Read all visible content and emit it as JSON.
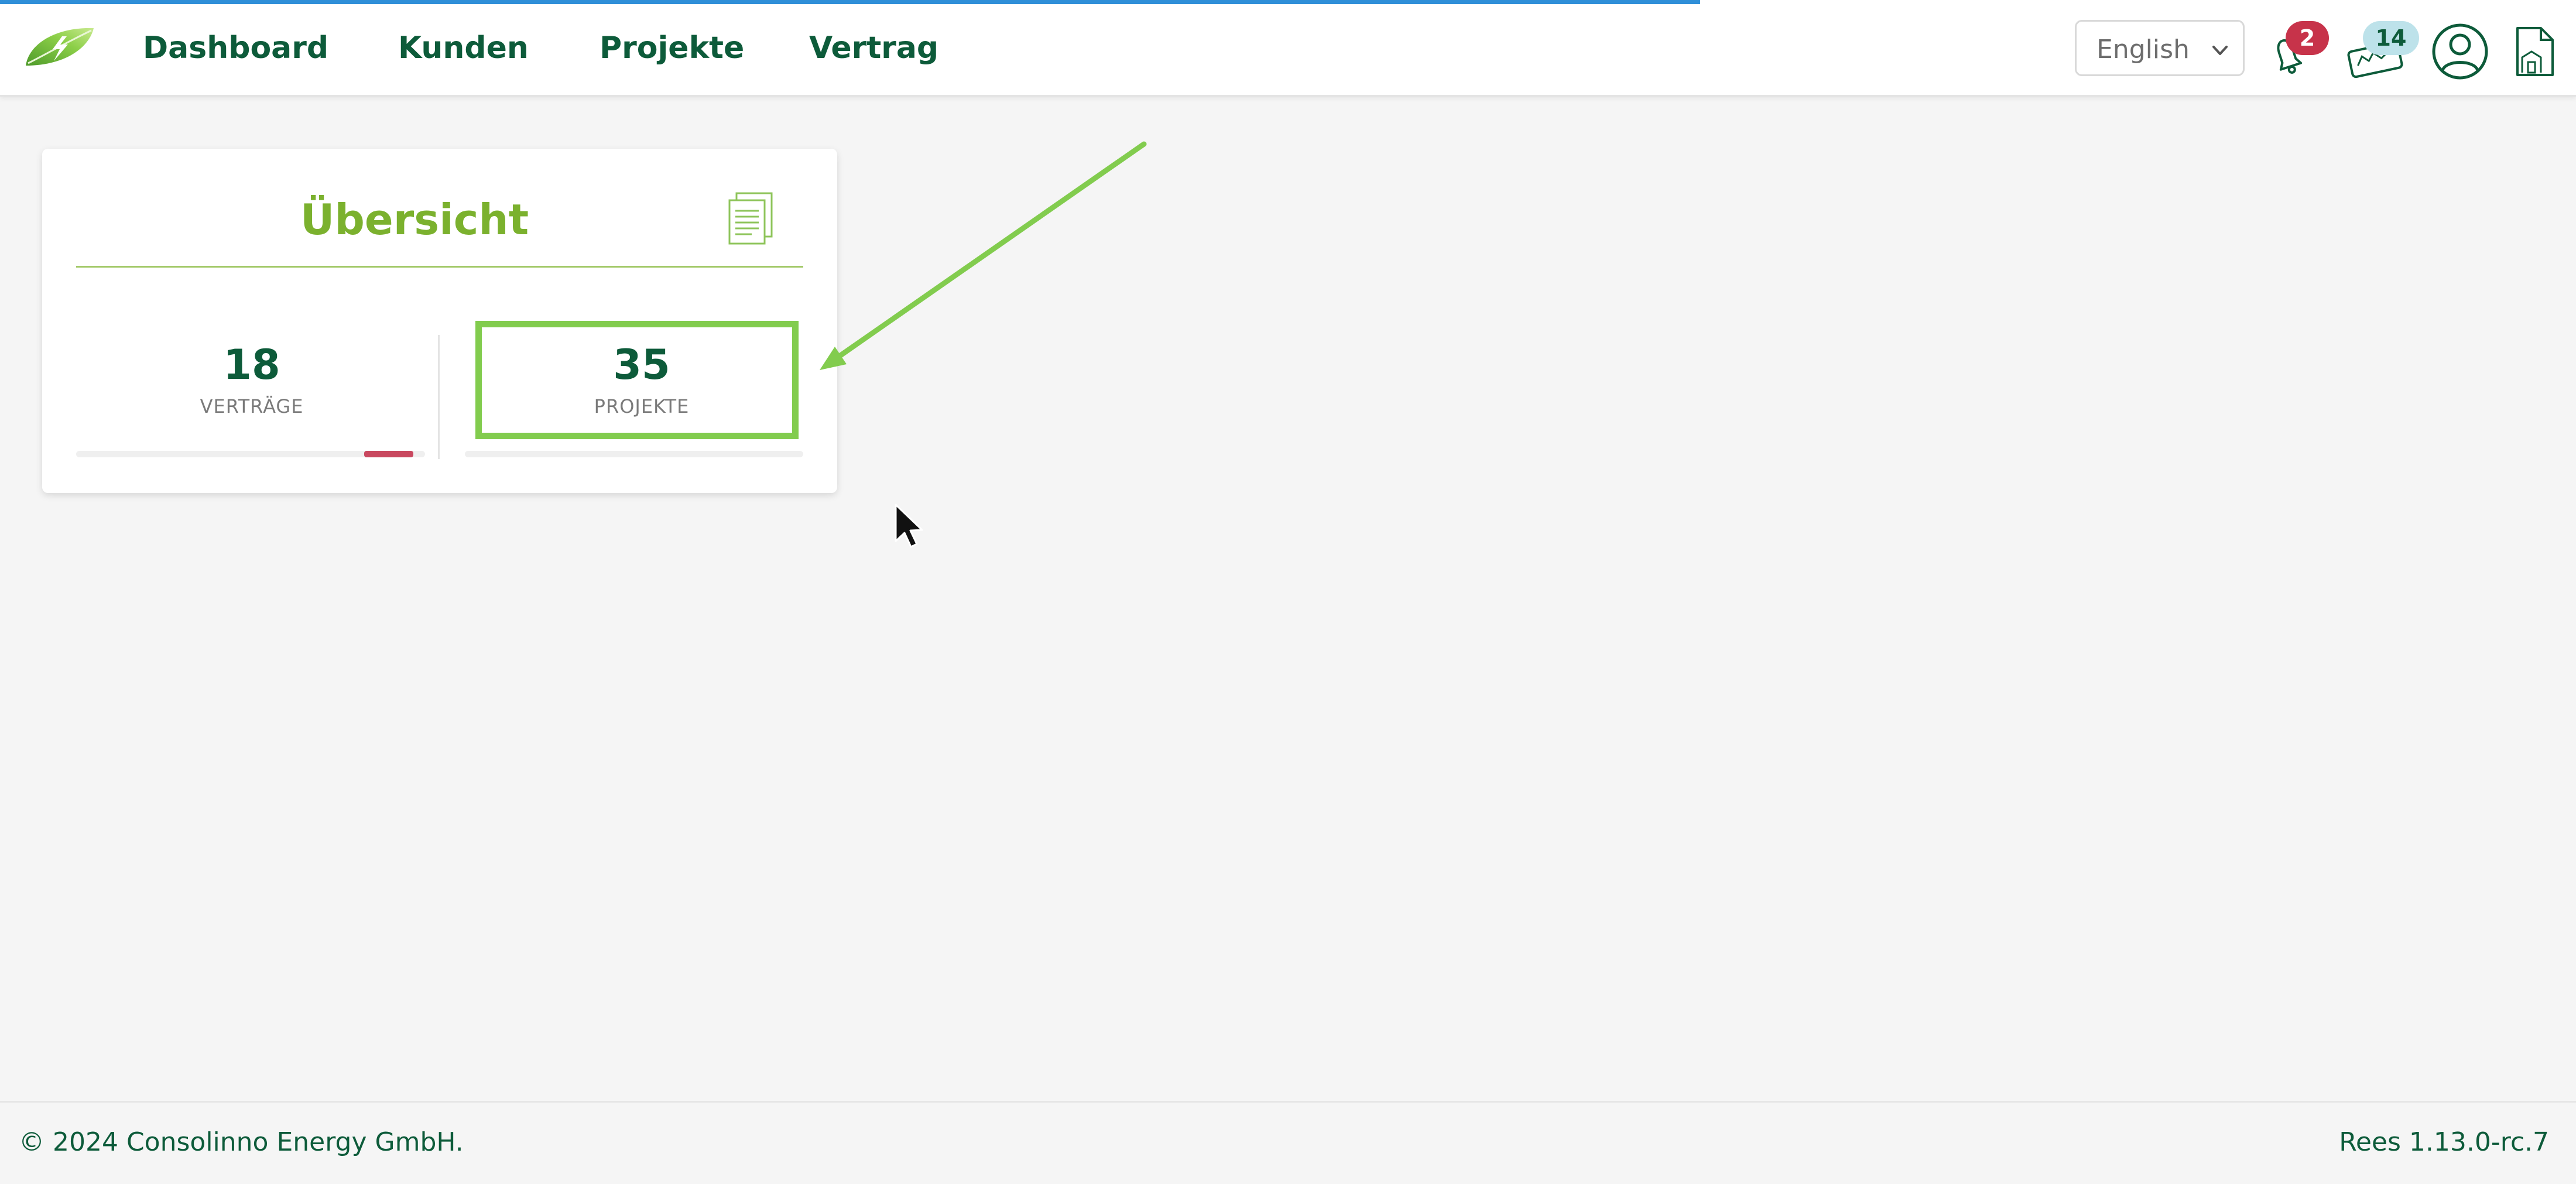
{
  "loading_progress": 0.66,
  "header": {
    "nav": [
      "Dashboard",
      "Kunden",
      "Projekte",
      "Vertrag"
    ],
    "language": {
      "selected": "English"
    },
    "notifications_badge": "2",
    "news_badge": "14",
    "icons": [
      "app-logo-icon",
      "bell-icon",
      "news-icon",
      "user-account-icon",
      "building-document-icon"
    ]
  },
  "overview_card": {
    "title": "Übersicht",
    "stats": [
      {
        "value": "18",
        "label": "VERTRÄGE"
      },
      {
        "value": "35",
        "label": "PROJEKTE"
      }
    ]
  },
  "footer": {
    "copyright": "© 2024 Consolinno Energy GmbH.",
    "version": "Rees 1.13.0-rc.7"
  },
  "colors": {
    "brand_dark_green": "#0d5b3a",
    "brand_light_green": "#7bb12e",
    "highlight_green": "#82cc4e",
    "badge_red": "#c7334a",
    "badge_blue": "#bde2ea",
    "loading_blue": "#2f8fd8",
    "page_background": "#f5f5f5"
  }
}
